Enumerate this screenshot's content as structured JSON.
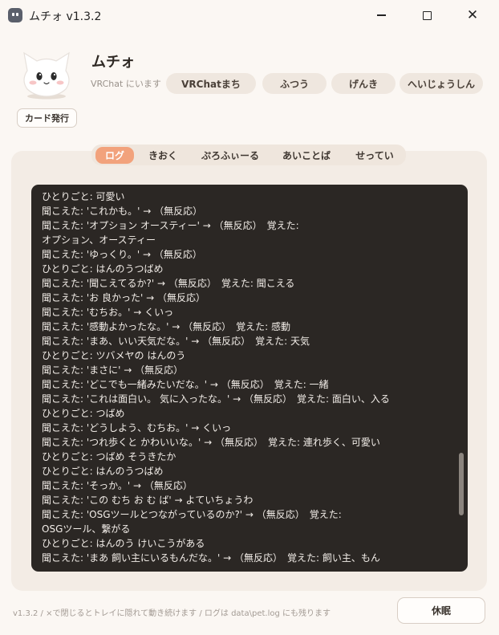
{
  "window": {
    "title": "ムチォ v1.3.2",
    "min_icon": "minimize-icon",
    "max_icon": "maximize-icon",
    "close_icon": "close-icon",
    "close_label": "✕"
  },
  "header": {
    "pet_name": "ムチォ",
    "status": "VRChat にいます",
    "moods": [
      "VRChatまち",
      "ふつう",
      "げんき",
      "へいじょうしん"
    ],
    "card_button": "カード発行"
  },
  "tabs": [
    "ログ",
    "きおく",
    "ぷろふぃーる",
    "あいことば",
    "せってい"
  ],
  "active_tab": "ログ",
  "log": [
    "ひとりごと: 可愛い",
    "聞こえた: 'これかも。' → （無反応）",
    "聞こえた: 'オプション オースティー' → （無反応）　覚えた:",
    "オプション、オースティー",
    "聞こえた: 'ゆっくり。' → （無反応）",
    "ひとりごと: はんのうつばめ",
    "聞こえた: '聞こえてるか?' → （無反応）　覚えた: 聞こえる",
    "聞こえた: 'お 良かった' → （無反応）",
    "聞こえた: 'むちお。' → くいっ",
    "聞こえた: '感動よかったな。' → （無反応）　覚えた: 感動",
    "聞こえた: 'まあ、いい天気だな。' → （無反応）　覚えた: 天気",
    "ひとりごと: ツバメヤの はんのう",
    "聞こえた: 'まさに' → （無反応）",
    "聞こえた: 'どこでも一緒みたいだな。' → （無反応）　覚えた: 一緒",
    "聞こえた: 'これは面白い。 気に入ったな。' → （無反応）　覚えた: 面白い、入る",
    "ひとりごと: つばめ",
    "聞こえた: 'どうしよう、むちお。' → くいっ",
    "聞こえた: 'つれ歩くと かわいいな。' → （無反応）　覚えた: 連れ歩く、可愛い",
    "ひとりごと: つばめ そうきたか",
    "ひとりごと: はんのうつばめ",
    "聞こえた: 'そっか。' → （無反応）",
    "聞こえた: 'この むち お む ば' → よていちょうわ",
    "聞こえた: 'OSGツールとつながっているのか?' → （無反応）　覚えた:",
    "OSGツール、繋がる",
    "ひとりごと: はんのう けいこうがある",
    "聞こえた: 'まあ 飼い主にいるもんだな。' → （無反応）　覚えた: 飼い主、もん"
  ],
  "footer": {
    "text": "v1.3.2 / ×で閉じるとトレイに隠れて動き続けます / ログは data\\pet.log にも残ります",
    "sleep_button": "休眠"
  },
  "colors": {
    "accent": "#f2a27c",
    "background": "#fbf7f3",
    "panel": "#f3ece5",
    "log_background": "#2b2724",
    "log_text": "#f2ede8"
  }
}
